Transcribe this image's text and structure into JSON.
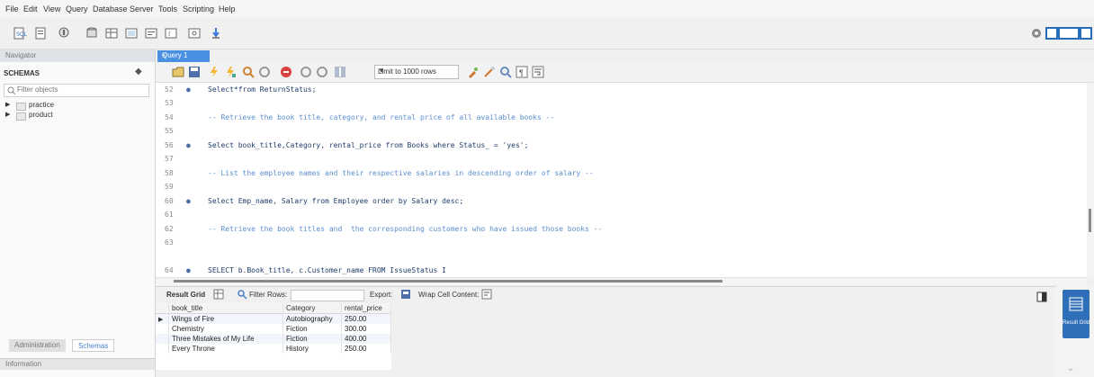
{
  "menu": [
    "File",
    "Edit",
    "View",
    "Query",
    "Database",
    "Server",
    "Tools",
    "Scripting",
    "Help"
  ],
  "navigator": {
    "header": "Navigator",
    "schemas_title": "SCHEMAS",
    "filter_placeholder": "Filter objects",
    "schemas": [
      "practice",
      "product"
    ],
    "tabs": [
      "Administration",
      "Schemas"
    ],
    "info_label": "Information"
  },
  "query_tab": {
    "label": "Query 1",
    "close": "×"
  },
  "query_toolbar": {
    "limit_label": "Limit to 1000 rows"
  },
  "editor": {
    "lines": [
      {
        "n": "52",
        "bullet": "●",
        "code": "Select*from ReturnStatus;",
        "type": "code"
      },
      {
        "n": "53",
        "bullet": "",
        "code": "",
        "type": "code"
      },
      {
        "n": "54",
        "bullet": "",
        "code": "-- Retrieve the book title, category, and rental price of all available books --",
        "type": "comment"
      },
      {
        "n": "55",
        "bullet": "",
        "code": "",
        "type": "code"
      },
      {
        "n": "56",
        "bullet": "●",
        "code": "Select book_title,Category, rental_price from Books where Status_ = 'yes';",
        "type": "code"
      },
      {
        "n": "57",
        "bullet": "",
        "code": "",
        "type": "code"
      },
      {
        "n": "58",
        "bullet": "",
        "code": "-- List the employee names and their respective salaries in descending order of salary --",
        "type": "comment"
      },
      {
        "n": "59",
        "bullet": "",
        "code": "",
        "type": "code"
      },
      {
        "n": "60",
        "bullet": "●",
        "code": "Select Emp_name, Salary from Employee order by Salary desc;",
        "type": "code"
      },
      {
        "n": "61",
        "bullet": "",
        "code": "",
        "type": "code"
      },
      {
        "n": "62",
        "bullet": "",
        "code": "-- Retrieve the book titles and  the corresponding customers who have issued those books --",
        "type": "comment"
      },
      {
        "n": "63",
        "bullet": "",
        "code": "",
        "type": "code"
      },
      {
        "n": "64",
        "bullet": "●",
        "code": "SELECT b.Book_title, c.Customer_name FROM IssueStatus I",
        "type": "code"
      }
    ]
  },
  "result_toolbar": {
    "result_grid": "Result Grid",
    "filter_rows": "Filter Rows:",
    "export": "Export:",
    "wrap": "Wrap Cell Content:"
  },
  "result": {
    "columns": [
      "book_title",
      "Category",
      "rental_price"
    ],
    "rows": [
      [
        "Wings of Fire",
        "Autobiography",
        "250.00"
      ],
      [
        "Chemistry",
        "Fiction",
        "300.00"
      ],
      [
        "Three Mistakes of My Life",
        "Fiction",
        "400.00"
      ],
      [
        "Every Throne",
        "History",
        "250.00"
      ]
    ]
  },
  "right_panel": {
    "form_label": "Result Grid"
  }
}
